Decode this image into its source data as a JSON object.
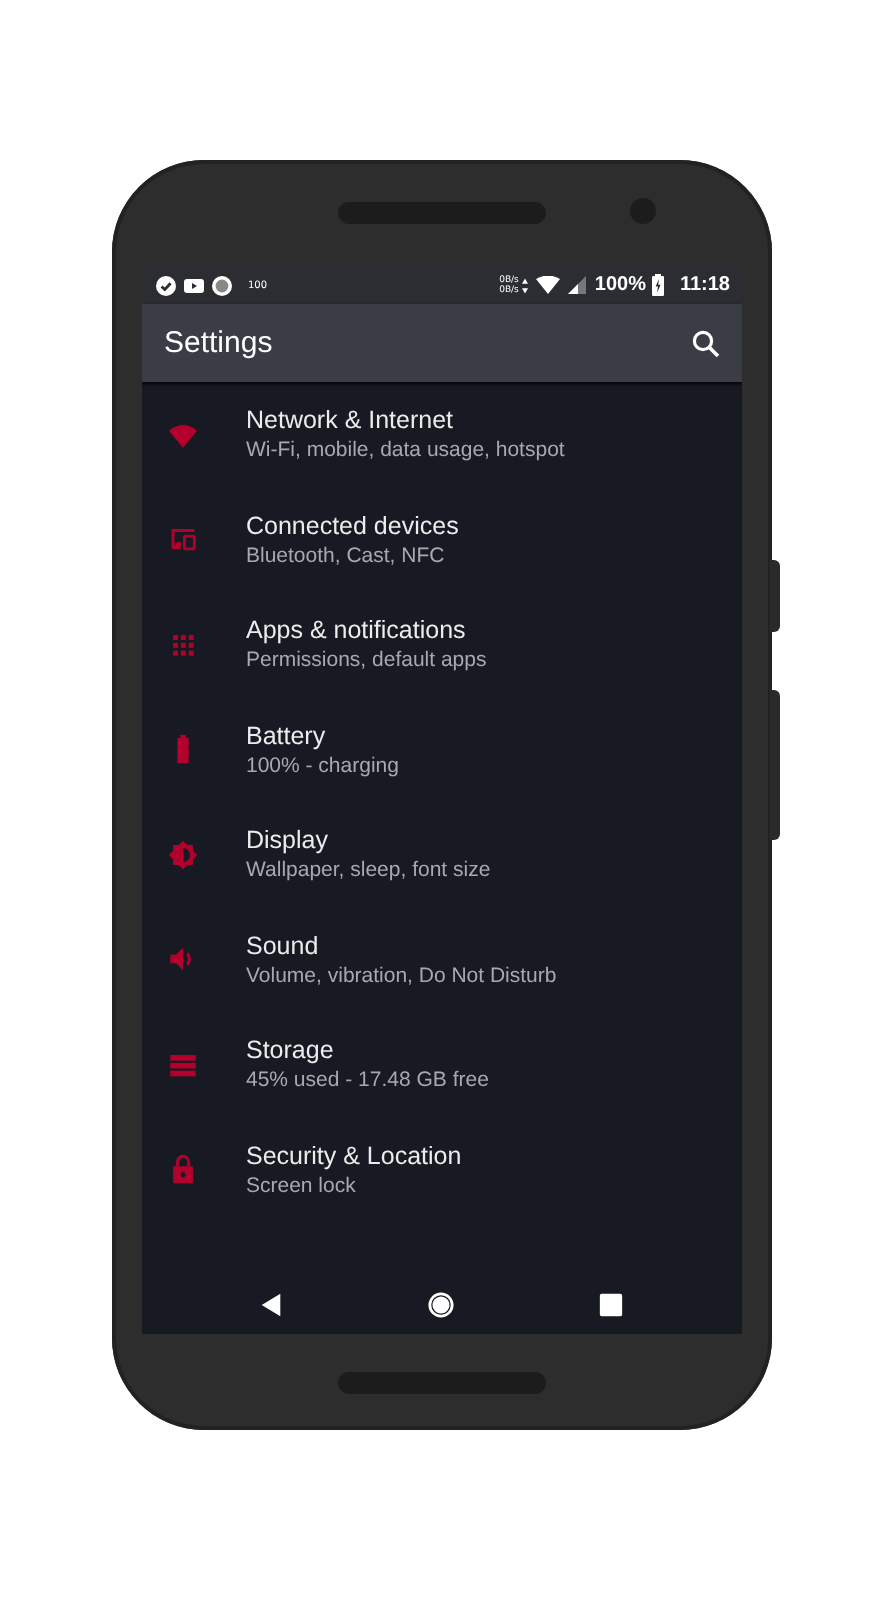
{
  "status_bar": {
    "notification_text": "100",
    "speeds": [
      "0B/s",
      "0B/s"
    ],
    "battery": "100%",
    "time": "11:18"
  },
  "toolbar": {
    "title": "Settings"
  },
  "items": [
    {
      "title": "Network & Internet",
      "subtitle": "Wi-Fi, mobile, data usage, hotspot"
    },
    {
      "title": "Connected devices",
      "subtitle": "Bluetooth, Cast, NFC"
    },
    {
      "title": "Apps & notifications",
      "subtitle": "Permissions, default apps"
    },
    {
      "title": "Battery",
      "subtitle": "100% - charging"
    },
    {
      "title": "Display",
      "subtitle": "Wallpaper, sleep, font size"
    },
    {
      "title": "Sound",
      "subtitle": "Volume, vibration, Do Not Disturb"
    },
    {
      "title": "Storage",
      "subtitle": "45% used - 17.48 GB free"
    },
    {
      "title": "Security & Location",
      "subtitle": "Screen lock"
    }
  ]
}
